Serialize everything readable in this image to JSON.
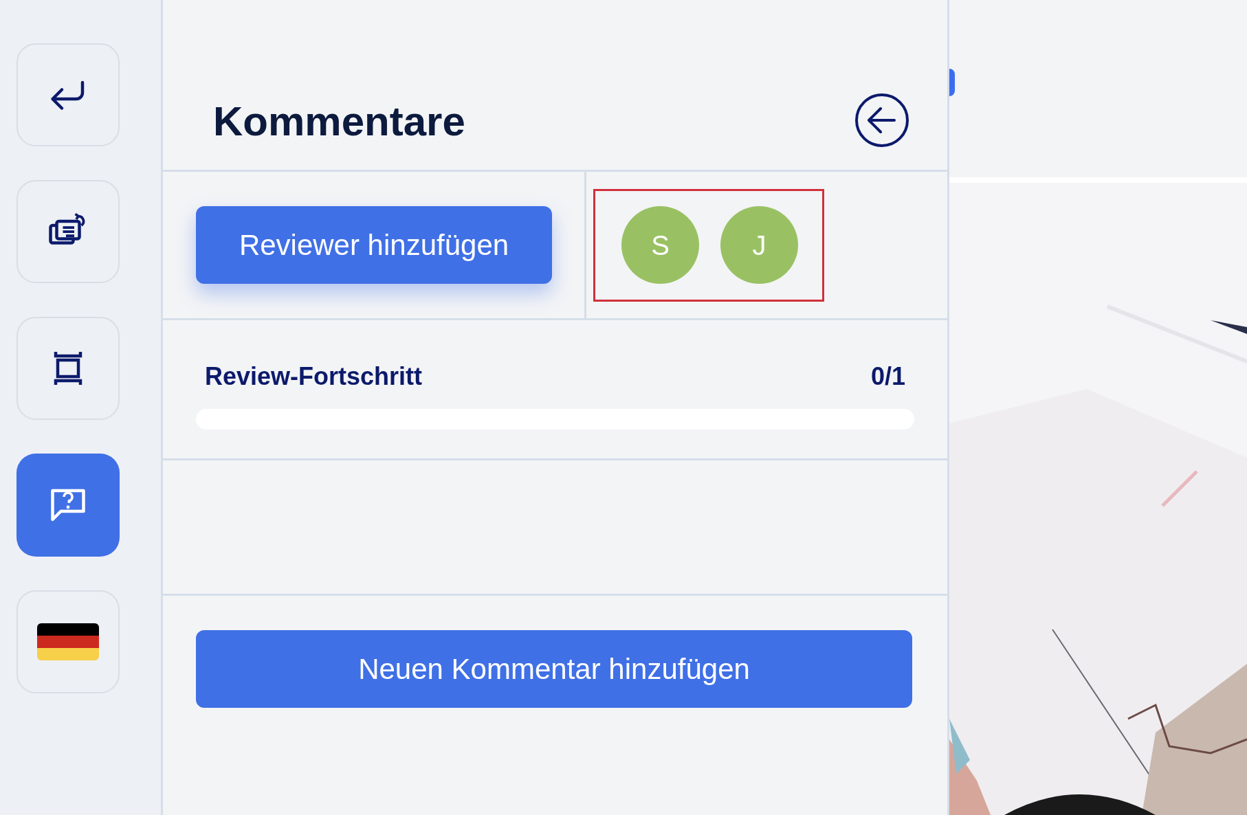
{
  "sidebar": {
    "items": [
      {
        "kind": "return",
        "selected": false
      },
      {
        "kind": "cards",
        "selected": false
      },
      {
        "kind": "frame",
        "selected": false
      },
      {
        "kind": "question",
        "selected": true
      },
      {
        "kind": "flag",
        "selected": false
      }
    ]
  },
  "panel": {
    "title": "Kommentare",
    "add_reviewer_button": "Reviewer hinzufügen",
    "reviewers": [
      {
        "initial": "S",
        "color": "#99c163"
      },
      {
        "initial": "J",
        "color": "#99c163"
      }
    ],
    "progress": {
      "label": "Review-Fortschritt",
      "reading": "0/1",
      "level": 0
    },
    "new_comment_button": "Neuen Kommentar hinzufügen"
  }
}
